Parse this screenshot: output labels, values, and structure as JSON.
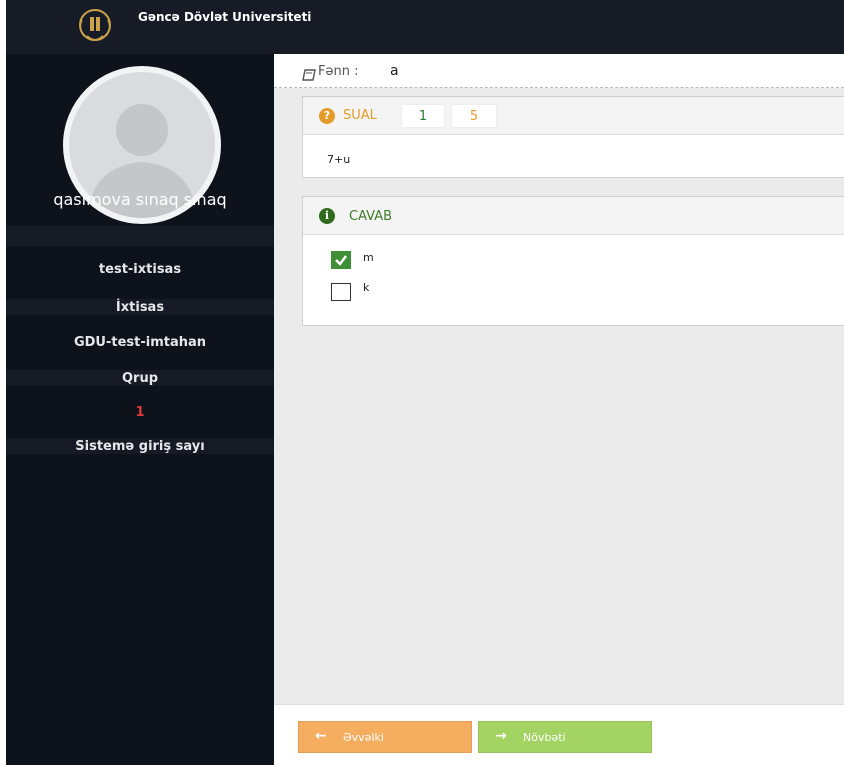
{
  "header": {
    "university_name": "Gəncə Dövlət Universiteti"
  },
  "sidebar": {
    "user_name": "qasımova sınaq sınaq",
    "items": [
      {
        "value": "test-ixtisas"
      },
      {
        "value": "İxtisas"
      },
      {
        "value": "GDU-test-imtahan"
      },
      {
        "value": "Qrup"
      },
      {
        "value": "1"
      },
      {
        "value": "Sistemə giriş sayı"
      }
    ]
  },
  "subject": {
    "label": "Fənn :",
    "value": "a"
  },
  "question": {
    "label": "SUAL",
    "number": "1",
    "total": "5",
    "text": "7+u"
  },
  "answer": {
    "label": "CAVAB",
    "options": [
      {
        "label": "m",
        "checked": true
      },
      {
        "label": "k",
        "checked": false
      }
    ]
  },
  "buttons": {
    "prev": "Əvvəlki",
    "next": "Növbəti"
  },
  "colors": {
    "prev": "#f5ad60",
    "next": "#a3d463",
    "sual": "#e49b29",
    "cavab": "#3f7a2a"
  }
}
